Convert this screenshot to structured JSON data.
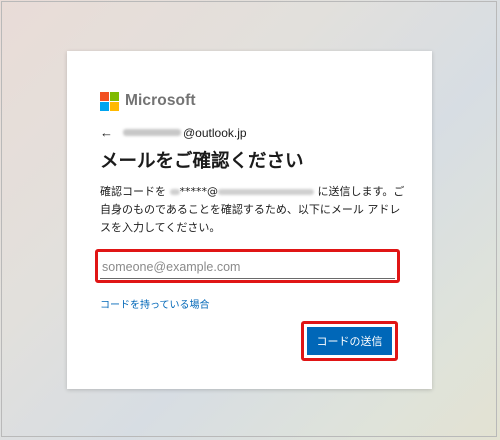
{
  "colors": {
    "accent": "#0067b8",
    "highlight": "#e01515",
    "logo_red": "#f25022",
    "logo_green": "#7fba00",
    "logo_blue": "#00a4ef",
    "logo_yellow": "#ffb900"
  },
  "header": {
    "logo_text": "Microsoft",
    "back_icon": "←",
    "identity_suffix": "@outlook.jp"
  },
  "main": {
    "title": "メールをご確認ください",
    "description_prefix": "確認コードを ",
    "description_masked": "*****@",
    "description_suffix": " に送信します。ご自身のものであることを確認するため、以下にメール アドレスを入力してください。",
    "email_input": {
      "placeholder": "someone@example.com",
      "value": ""
    },
    "have_code_link": "コードを持っている場合",
    "send_code_button": "コードの送信"
  }
}
